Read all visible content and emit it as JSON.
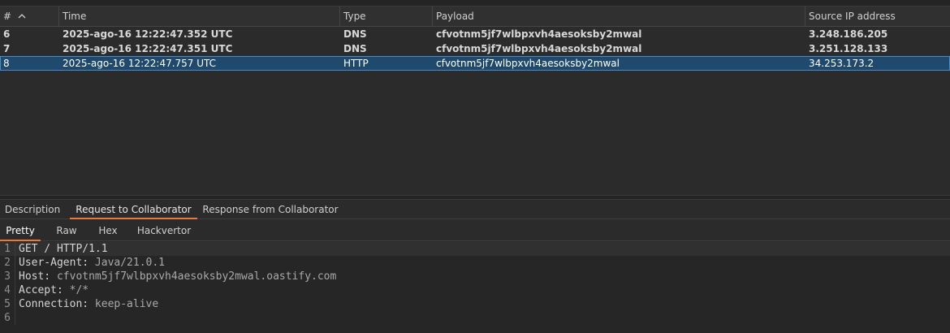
{
  "table": {
    "columns": {
      "num": "#",
      "time": "Time",
      "type": "Type",
      "payload": "Payload",
      "ip": "Source IP address"
    },
    "rows": [
      {
        "num": "6",
        "time": "2025-ago-16 12:22:47.352 UTC",
        "type": "DNS",
        "payload": "cfvotnm5jf7wlbpxvh4aesoksby2mwal",
        "ip": "3.248.186.205"
      },
      {
        "num": "7",
        "time": "2025-ago-16 12:22:47.351 UTC",
        "type": "DNS",
        "payload": "cfvotnm5jf7wlbpxvh4aesoksby2mwal",
        "ip": "3.251.128.133"
      },
      {
        "num": "8",
        "time": "2025-ago-16 12:22:47.757 UTC",
        "type": "HTTP",
        "payload": "cfvotnm5jf7wlbpxvh4aesoksby2mwal",
        "ip": "34.253.173.2"
      }
    ]
  },
  "main_tabs": {
    "description": "Description",
    "request": "Request to Collaborator",
    "response": "Response from Collaborator"
  },
  "sub_tabs": {
    "pretty": "Pretty",
    "raw": "Raw",
    "hex": "Hex",
    "hackvertor": "Hackvertor"
  },
  "editor": {
    "lines": [
      {
        "num": "1",
        "key": "GET / HTTP/1.1",
        "value": ""
      },
      {
        "num": "2",
        "key": "User-Agent:",
        "value": " Java/21.0.1"
      },
      {
        "num": "3",
        "key": "Host:",
        "value": " cfvotnm5jf7wlbpxvh4aesoksby2mwal.oastify.com"
      },
      {
        "num": "4",
        "key": "Accept:",
        "value": " */*"
      },
      {
        "num": "5",
        "key": "Connection:",
        "value": " keep-alive"
      },
      {
        "num": "6",
        "key": "",
        "value": ""
      }
    ]
  },
  "colors": {
    "accent": "#e8793a",
    "selected_row": "#1f4a6e"
  }
}
